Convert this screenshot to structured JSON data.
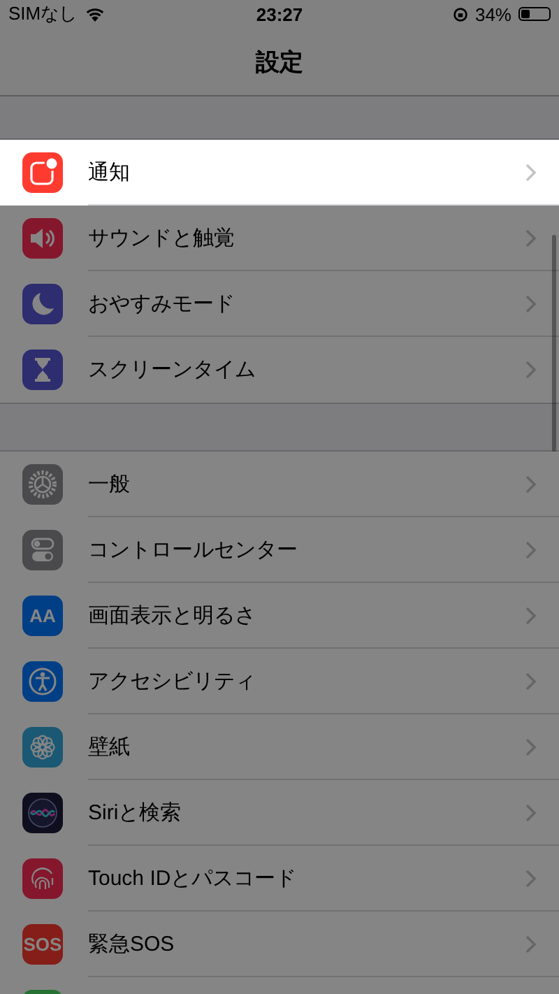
{
  "status_bar": {
    "carrier": "SIMなし",
    "time": "23:27",
    "battery": "34%"
  },
  "nav": {
    "title": "設定"
  },
  "sections": [
    {
      "items": [
        {
          "label": "通知",
          "kind": "notification",
          "highlighted": true
        },
        {
          "label": "サウンドと触覚",
          "kind": "sound",
          "highlighted": false
        },
        {
          "label": "おやすみモード",
          "kind": "moon",
          "highlighted": false
        },
        {
          "label": "スクリーンタイム",
          "kind": "hourglass",
          "highlighted": false
        }
      ]
    },
    {
      "items": [
        {
          "label": "一般",
          "kind": "gear",
          "highlighted": false
        },
        {
          "label": "コントロールセンター",
          "kind": "toggles",
          "highlighted": false
        },
        {
          "label": "画面表示と明るさ",
          "kind": "display",
          "icon_text": "AA",
          "highlighted": false
        },
        {
          "label": "アクセシビリティ",
          "kind": "person",
          "highlighted": false
        },
        {
          "label": "壁紙",
          "kind": "flower",
          "highlighted": false
        },
        {
          "label": "Siriと検索",
          "kind": "siri",
          "highlighted": false
        },
        {
          "label": "Touch IDとパスコード",
          "kind": "fingerprint",
          "highlighted": false
        },
        {
          "label": "緊急SOS",
          "kind": "sos",
          "icon_text": "SOS",
          "highlighted": false
        }
      ]
    }
  ]
}
